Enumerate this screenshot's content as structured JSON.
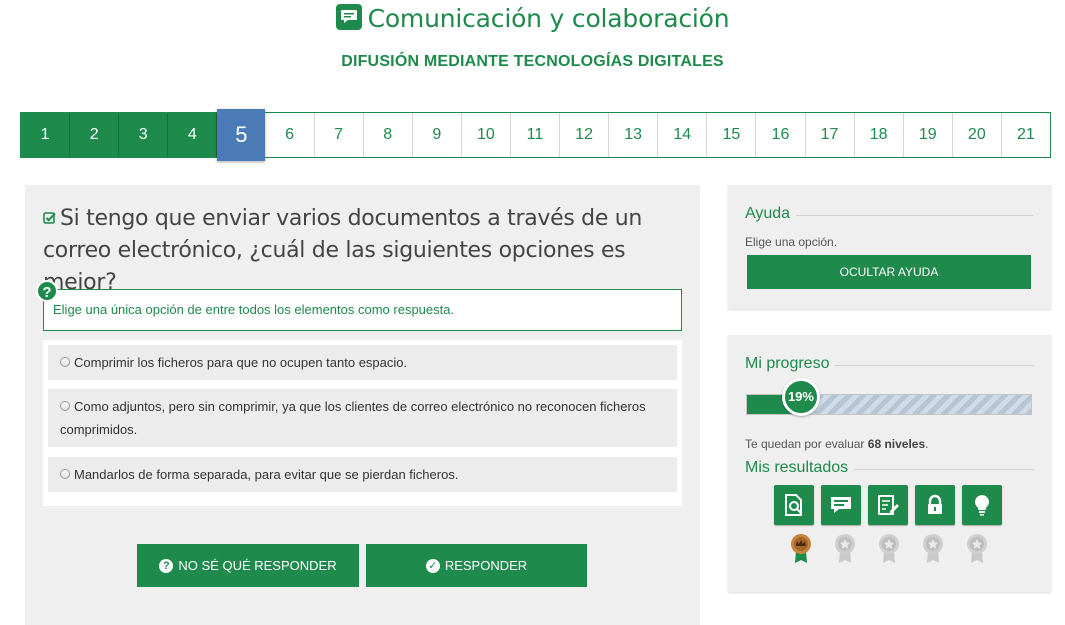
{
  "header": {
    "title": "Comunicación y colaboración",
    "subtitle": "DIFUSIÓN MEDIANTE TECNOLOGÍAS DIGITALES",
    "title_icon": "chat-icon"
  },
  "levels": {
    "items": [
      "1",
      "2",
      "3",
      "4",
      "5",
      "6",
      "7",
      "8",
      "9",
      "10",
      "11",
      "12",
      "13",
      "14",
      "15",
      "16",
      "17",
      "18",
      "19",
      "20",
      "21"
    ],
    "completed": [
      "1",
      "2",
      "3",
      "4"
    ],
    "current": "5"
  },
  "question": {
    "text": "Si tengo que enviar varios documentos a través de un correo electrónico, ¿cuál de las siguientes opciones es mejor?",
    "hint": "Elige una única opción de entre todos los elementos como respuesta.",
    "help_badge": "?",
    "options": [
      "Comprimir los ficheros para que no ocupen tanto espacio.",
      "Como adjuntos, pero sin comprimir, ya que los clientes de correo electrónico no reconocen ficheros comprimidos.",
      "Mandarlos de forma separada, para evitar que se pierdan ficheros."
    ],
    "dont_know_label": "NO SÉ QUÉ RESPONDER",
    "answer_label": "RESPONDER"
  },
  "help_panel": {
    "heading": "Ayuda",
    "text": "Elige una opción.",
    "button_label": "OCULTAR AYUDA"
  },
  "progress_panel": {
    "heading": "Mi progreso",
    "percent": 19,
    "percent_label": "19%",
    "remaining_prefix": "Te quedan por evaluar ",
    "remaining_count": "68 niveles",
    "remaining_suffix": ".",
    "results_heading": "Mis resultados",
    "result_icons": [
      "document-search-icon",
      "chat-icon",
      "edit-document-icon",
      "lock-icon",
      "lightbulb-icon"
    ],
    "medals": [
      "bronze",
      "grey",
      "grey",
      "grey",
      "grey"
    ]
  },
  "colors": {
    "accent": "#1e8a4c",
    "current_level": "#4a7bb7",
    "panel_bg": "#efefef"
  }
}
